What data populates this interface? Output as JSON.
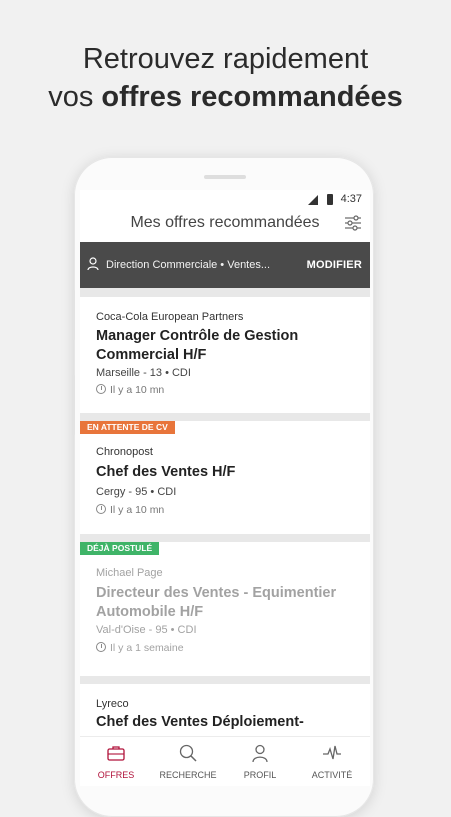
{
  "headline": {
    "line1": "Retrouvez rapidement",
    "line2_prefix": "vos ",
    "line2_bold": "offres recommandées"
  },
  "status": {
    "time": "4:37"
  },
  "appbar": {
    "title": "Mes offres recommandées"
  },
  "search": {
    "query": "Direction Commerciale • Ventes...",
    "action": "MODIFIER"
  },
  "offers": [
    {
      "badge": "",
      "company": "Coca-Cola European Partners",
      "title": "Manager Contrôle de Gestion Commercial H/F",
      "location": "Marseille - 13 • CDI",
      "posted": "Il y a 10 mn"
    },
    {
      "badge": "EN ATTENTE DE CV",
      "company": "Chronopost",
      "title": "Chef des Ventes H/F",
      "location": "Cergy - 95 • CDI",
      "posted": "Il y a 10 mn"
    },
    {
      "badge": "DÉJÀ POSTULÉ",
      "company": "Michael Page",
      "title": "Directeur des Ventes - Equimentier Automobile H/F",
      "location": "Val-d'Oise - 95 • CDI",
      "posted": "Il y a 1 semaine"
    },
    {
      "badge": "",
      "company": "Lyreco",
      "title": "Chef des Ventes Déploiement-",
      "location": "",
      "posted": ""
    }
  ],
  "nav": [
    {
      "label": "OFFRES",
      "icon": "briefcase-icon",
      "active": true
    },
    {
      "label": "RECHERCHE",
      "icon": "search-icon",
      "active": false
    },
    {
      "label": "PROFIL",
      "icon": "user-icon",
      "active": false
    },
    {
      "label": "ACTIVITÉ",
      "icon": "activity-icon",
      "active": false
    }
  ],
  "colors": {
    "accent": "#b0123a",
    "badge_waiting": "#e8753b",
    "badge_applied": "#3fb468",
    "searchbar": "#4a4a4a"
  }
}
